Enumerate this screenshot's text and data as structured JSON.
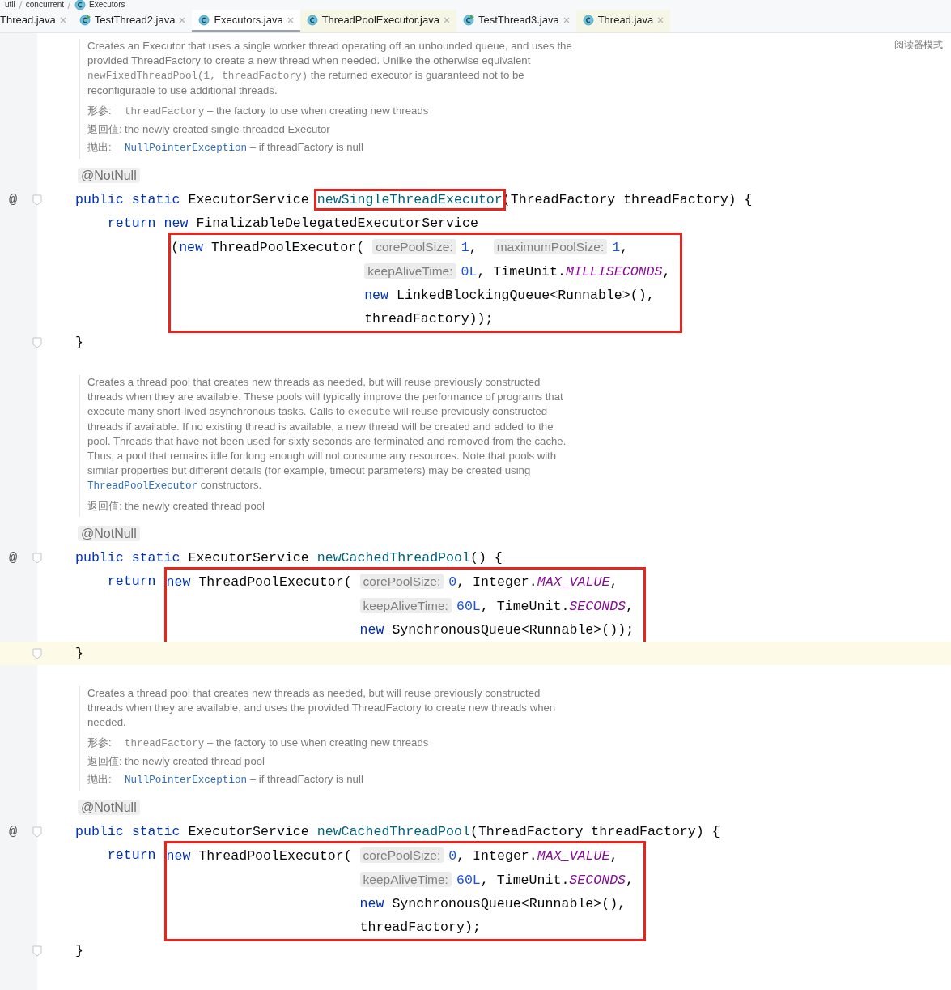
{
  "breadcrumb": [
    {
      "label": "util",
      "kind": "folder"
    },
    {
      "label": "concurrent",
      "kind": "folder"
    },
    {
      "label": "Executors",
      "kind": "class"
    }
  ],
  "tabs": [
    {
      "label": "Thread.java",
      "kind": "none",
      "library": false,
      "selected": false
    },
    {
      "label": "TestThread2.java",
      "kind": "runnable",
      "library": false,
      "selected": false
    },
    {
      "label": "Executors.java",
      "kind": "class",
      "library": false,
      "selected": true
    },
    {
      "label": "ThreadPoolExecutor.java",
      "kind": "class",
      "library": true,
      "selected": false
    },
    {
      "label": "TestThread3.java",
      "kind": "runnable",
      "library": false,
      "selected": false
    },
    {
      "label": "Thread.java",
      "kind": "class",
      "library": true,
      "selected": false
    }
  ],
  "reader_mode": "阅读器模式",
  "sections": [
    {
      "doc": {
        "paragraph": [
          {
            "kind": "text",
            "t": "Creates an Executor that uses a single worker thread operating off an unbounded queue, and uses the provided ThreadFactory to create a new thread when needed. Unlike the otherwise equivalent "
          },
          {
            "kind": "code",
            "t": "newFixedThreadPool(1, threadFactory)"
          },
          {
            "kind": "text",
            "t": "    the returned executor is guaranteed not to be reconfigurable to use additional threads."
          }
        ],
        "tags": [
          {
            "label": "形参:",
            "parts": [
              {
                "kind": "code",
                "t": "threadFactory"
              },
              {
                "kind": "text",
                "t": " – the factory to use when creating new threads"
              }
            ]
          },
          {
            "label": "返回值:",
            "parts": [
              {
                "kind": "text",
                "t": "the newly created single-threaded Executor"
              }
            ]
          },
          {
            "label": "抛出:",
            "parts": [
              {
                "kind": "link",
                "t": "NullPointerException"
              },
              {
                "kind": "text",
                "t": " – if threadFactory is null"
              }
            ]
          }
        ]
      },
      "code": [
        {
          "kind": "member",
          "fold": false,
          "highlight": false,
          "tokens": [
            {
              "kind": "annot",
              "t": "@NotNull"
            }
          ]
        },
        {
          "kind": "member",
          "marker": "@",
          "fold": true,
          "highlight": false,
          "tokens": [
            {
              "kind": "kw",
              "t": "public static "
            },
            {
              "kind": "plain",
              "t": "ExecutorService "
            },
            {
              "kind": "decl",
              "t": "newSingleThreadExecutor",
              "boxed": true
            },
            {
              "kind": "plain",
              "t": "(ThreadFactory threadFactory) {"
            }
          ]
        },
        {
          "kind": "body",
          "fold": false,
          "highlight": false,
          "tokens": [
            {
              "kind": "kw",
              "t": "return new "
            },
            {
              "kind": "plain",
              "t": "FinalizableDelegatedExecutorService"
            }
          ]
        },
        {
          "kind": "inner",
          "fold": false,
          "highlight": false,
          "box": [
            {
              "kind": "start",
              "tokens": [
                {
                  "kind": "plain",
                  "t": "("
                },
                {
                  "kind": "kw",
                  "t": "new "
                },
                {
                  "kind": "plain",
                  "t": "ThreadPoolExecutor( "
                },
                {
                  "kind": "hint",
                  "t": "corePoolSize:"
                },
                {
                  "kind": "num",
                  "t": "1"
                },
                {
                  "kind": "plain",
                  "t": ",  "
                },
                {
                  "kind": "hint",
                  "t": "maximumPoolSize:"
                },
                {
                  "kind": "num",
                  "t": "1"
                },
                {
                  "kind": "plain",
                  "t": ","
                }
              ]
            },
            {
              "kind": "cont",
              "tokens": [
                {
                  "kind": "hint",
                  "t": "keepAliveTime:"
                },
                {
                  "kind": "num",
                  "t": "0L"
                },
                {
                  "kind": "plain",
                  "t": ", TimeUnit."
                },
                {
                  "kind": "const",
                  "t": "MILLISECONDS"
                },
                {
                  "kind": "plain",
                  "t": ","
                }
              ]
            },
            {
              "kind": "cont",
              "tokens": [
                {
                  "kind": "kw",
                  "t": "new "
                },
                {
                  "kind": "plain",
                  "t": "LinkedBlockingQueue<Runnable>(),"
                }
              ]
            },
            {
              "kind": "cont",
              "tokens": [
                {
                  "kind": "plain",
                  "t": "threadFactory));"
                }
              ]
            }
          ]
        },
        {
          "kind": "member",
          "fold": true,
          "highlight": false,
          "tokens": [
            {
              "kind": "plain",
              "t": "}"
            }
          ]
        }
      ]
    },
    {
      "doc": {
        "paragraph": [
          {
            "kind": "text",
            "t": "Creates a thread pool that creates new threads as needed, but will reuse previously constructed threads when they are available. These pools will typically improve the performance of programs that execute many short-lived asynchronous tasks. Calls to "
          },
          {
            "kind": "code",
            "t": "execute"
          },
          {
            "kind": "text",
            "t": " will reuse previously constructed threads if available. If no existing thread is available, a new thread will be created and added to the pool. Threads that have not been used for sixty seconds are terminated and removed from the cache. Thus, a pool that remains idle for long enough will not consume any resources. Note that pools with similar properties but different details (for example, timeout parameters) may be created using "
          },
          {
            "kind": "link",
            "t": "ThreadPoolExecutor"
          },
          {
            "kind": "text",
            "t": " constructors."
          }
        ],
        "tags": [
          {
            "label": "返回值:",
            "parts": [
              {
                "kind": "text",
                "t": "the newly created thread pool"
              }
            ]
          }
        ]
      },
      "code": [
        {
          "kind": "member",
          "fold": false,
          "highlight": false,
          "tokens": [
            {
              "kind": "annot",
              "t": "@NotNull"
            }
          ]
        },
        {
          "kind": "member",
          "marker": "@",
          "fold": true,
          "highlight": false,
          "tokens": [
            {
              "kind": "kw",
              "t": "public static "
            },
            {
              "kind": "plain",
              "t": "ExecutorService "
            },
            {
              "kind": "decl",
              "t": "newCachedThreadPool"
            },
            {
              "kind": "plain",
              "t": "() {"
            }
          ]
        },
        {
          "kind": "body",
          "fold": false,
          "highlight": false,
          "tokens": [
            {
              "kind": "kw",
              "t": "return"
            }
          ],
          "box": [
            {
              "kind": "start",
              "tokens": [
                {
                  "kind": "kw",
                  "t": "new "
                },
                {
                  "kind": "plain",
                  "t": "ThreadPoolExecutor( "
                },
                {
                  "kind": "hint",
                  "t": "corePoolSize:"
                },
                {
                  "kind": "num",
                  "t": "0"
                },
                {
                  "kind": "plain",
                  "t": ", Integer."
                },
                {
                  "kind": "const",
                  "t": "MAX_VALUE"
                },
                {
                  "kind": "plain",
                  "t": ","
                }
              ]
            },
            {
              "kind": "cont",
              "tokens": [
                {
                  "kind": "hint",
                  "t": "keepAliveTime:"
                },
                {
                  "kind": "num",
                  "t": "60L"
                },
                {
                  "kind": "plain",
                  "t": ", TimeUnit."
                },
                {
                  "kind": "const",
                  "t": "SECONDS"
                },
                {
                  "kind": "plain",
                  "t": ","
                }
              ]
            },
            {
              "kind": "cont",
              "tokens": [
                {
                  "kind": "kw",
                  "t": "new "
                },
                {
                  "kind": "plain",
                  "t": "SynchronousQueue<Runnable>());"
                }
              ]
            }
          ]
        },
        {
          "kind": "member",
          "fold": true,
          "highlight": true,
          "tokens": [
            {
              "kind": "plain",
              "t": "}"
            }
          ]
        }
      ]
    },
    {
      "doc": {
        "paragraph": [
          {
            "kind": "text",
            "t": "Creates a thread pool that creates new threads as needed, but will reuse previously constructed threads when they are available, and uses the provided ThreadFactory to create new threads when needed."
          }
        ],
        "tags": [
          {
            "label": "形参:",
            "parts": [
              {
                "kind": "code",
                "t": "threadFactory"
              },
              {
                "kind": "text",
                "t": " – the factory to use when creating new threads"
              }
            ]
          },
          {
            "label": "返回值:",
            "parts": [
              {
                "kind": "text",
                "t": "the newly created thread pool"
              }
            ]
          },
          {
            "label": "抛出:",
            "parts": [
              {
                "kind": "link",
                "t": "NullPointerException"
              },
              {
                "kind": "text",
                "t": " – if threadFactory is null"
              }
            ]
          }
        ]
      },
      "code": [
        {
          "kind": "member",
          "fold": false,
          "highlight": false,
          "tokens": [
            {
              "kind": "annot",
              "t": "@NotNull"
            }
          ]
        },
        {
          "kind": "member",
          "marker": "@",
          "fold": true,
          "highlight": false,
          "tokens": [
            {
              "kind": "kw",
              "t": "public static "
            },
            {
              "kind": "plain",
              "t": "ExecutorService "
            },
            {
              "kind": "decl",
              "t": "newCachedThreadPool"
            },
            {
              "kind": "plain",
              "t": "(ThreadFactory threadFactory) {"
            }
          ]
        },
        {
          "kind": "body",
          "fold": false,
          "highlight": false,
          "tokens": [
            {
              "kind": "kw",
              "t": "return"
            }
          ],
          "box": [
            {
              "kind": "start",
              "tokens": [
                {
                  "kind": "kw",
                  "t": "new "
                },
                {
                  "kind": "plain",
                  "t": "ThreadPoolExecutor( "
                },
                {
                  "kind": "hint",
                  "t": "corePoolSize:"
                },
                {
                  "kind": "num",
                  "t": "0"
                },
                {
                  "kind": "plain",
                  "t": ", Integer."
                },
                {
                  "kind": "const",
                  "t": "MAX_VALUE"
                },
                {
                  "kind": "plain",
                  "t": ","
                }
              ]
            },
            {
              "kind": "cont",
              "tokens": [
                {
                  "kind": "hint",
                  "t": "keepAliveTime:"
                },
                {
                  "kind": "num",
                  "t": "60L"
                },
                {
                  "kind": "plain",
                  "t": ", TimeUnit."
                },
                {
                  "kind": "const",
                  "t": "SECONDS"
                },
                {
                  "kind": "plain",
                  "t": ","
                }
              ]
            },
            {
              "kind": "cont",
              "tokens": [
                {
                  "kind": "kw",
                  "t": "new "
                },
                {
                  "kind": "plain",
                  "t": "SynchronousQueue<Runnable>(),"
                }
              ]
            },
            {
              "kind": "cont",
              "tokens": [
                {
                  "kind": "plain",
                  "t": "threadFactory);"
                }
              ]
            }
          ]
        },
        {
          "kind": "member",
          "fold": true,
          "highlight": false,
          "tokens": [
            {
              "kind": "plain",
              "t": "}"
            }
          ]
        }
      ]
    }
  ]
}
